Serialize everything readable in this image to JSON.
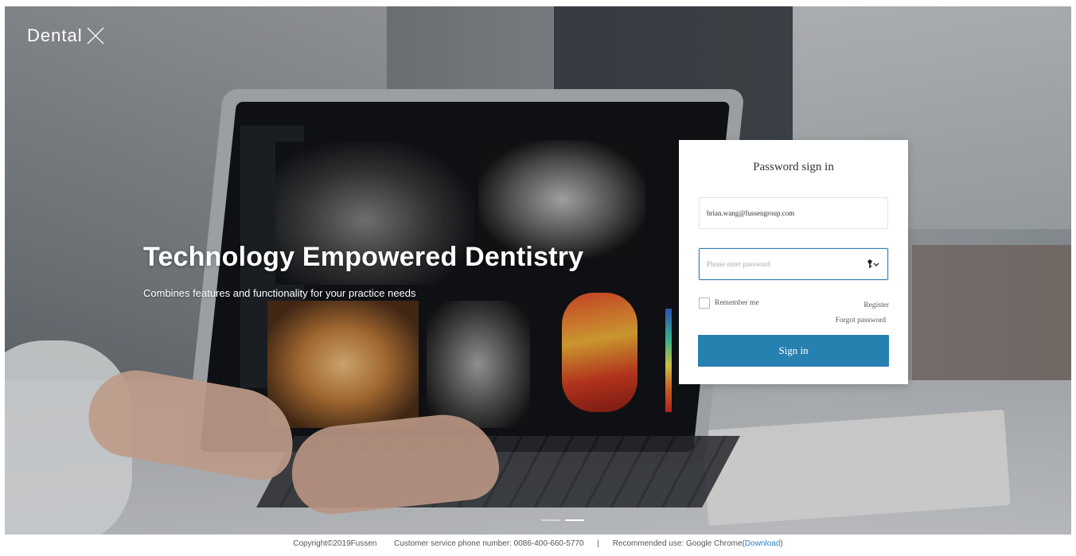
{
  "brand": {
    "name": "Dental"
  },
  "hero": {
    "headline": "Technology Empowered Dentistry",
    "subline": "Combines features and functionality for your practice needs",
    "carousel": {
      "count": 2,
      "active_index": 1
    }
  },
  "login": {
    "title": "Password sign in",
    "email_value": "brian.wang@fussengroup.com",
    "password_placeholder": "Please enter password",
    "remember_label": "Remember me",
    "register_label": "Register",
    "forgot_label": "Forgot password",
    "signin_label": "Sign in"
  },
  "footer": {
    "copyright": "Copyright©2019Fussen",
    "phone_label": "Customer service phone number: 0086-400-660-5770",
    "separator": "|",
    "recommend_prefix": "Recommended use: Google Chrome(",
    "download_link": "Download",
    "recommend_suffix": ")"
  },
  "colors": {
    "accent": "#2680b0",
    "link": "#2a7fc1"
  },
  "icons": {
    "brand": "x-logo-icon",
    "password": "key-icon"
  }
}
